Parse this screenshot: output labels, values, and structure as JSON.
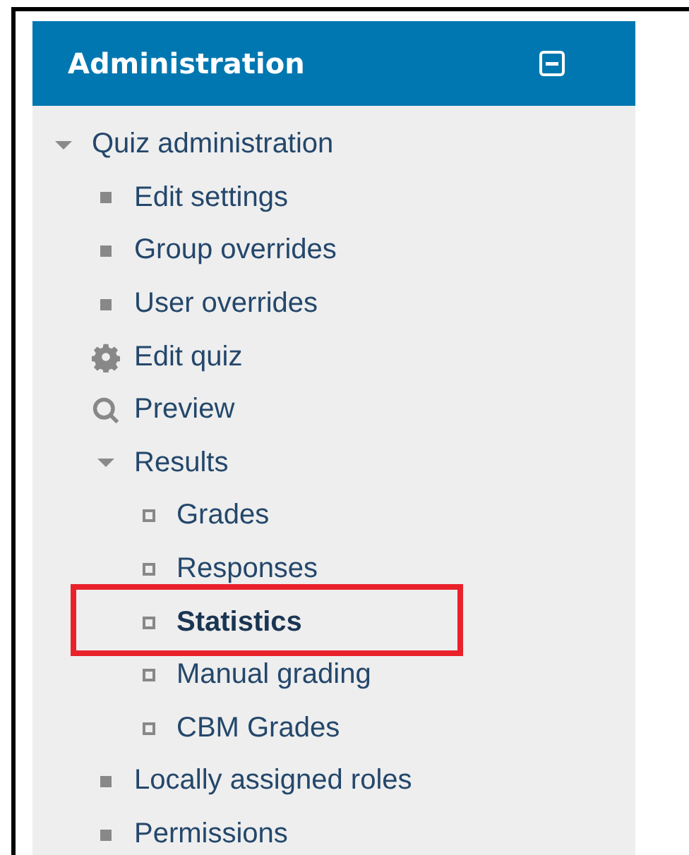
{
  "block": {
    "title": "Administration",
    "items": [
      {
        "kind": "folder",
        "label": "Quiz administration",
        "expanded": true,
        "selected": false,
        "children": [
          {
            "kind": "leaf",
            "label": "Edit settings",
            "selected": false
          },
          {
            "kind": "leaf",
            "label": "Group overrides",
            "selected": false
          },
          {
            "kind": "leaf",
            "label": "User overrides",
            "selected": false
          },
          {
            "kind": "gear",
            "label": "Edit quiz",
            "selected": false
          },
          {
            "kind": "search",
            "label": "Preview",
            "selected": false
          },
          {
            "kind": "folder",
            "label": "Results",
            "expanded": true,
            "selected": false,
            "children": [
              {
                "kind": "sub",
                "label": "Grades",
                "selected": false
              },
              {
                "kind": "sub",
                "label": "Responses",
                "selected": false
              },
              {
                "kind": "sub",
                "label": "Statistics",
                "selected": true
              },
              {
                "kind": "sub",
                "label": "Manual grading",
                "selected": false
              },
              {
                "kind": "sub",
                "label": "CBM Grades",
                "selected": false
              }
            ]
          },
          {
            "kind": "leaf",
            "label": "Locally assigned roles",
            "selected": false
          },
          {
            "kind": "leaf",
            "label": "Permissions",
            "selected": false
          }
        ]
      }
    ]
  }
}
